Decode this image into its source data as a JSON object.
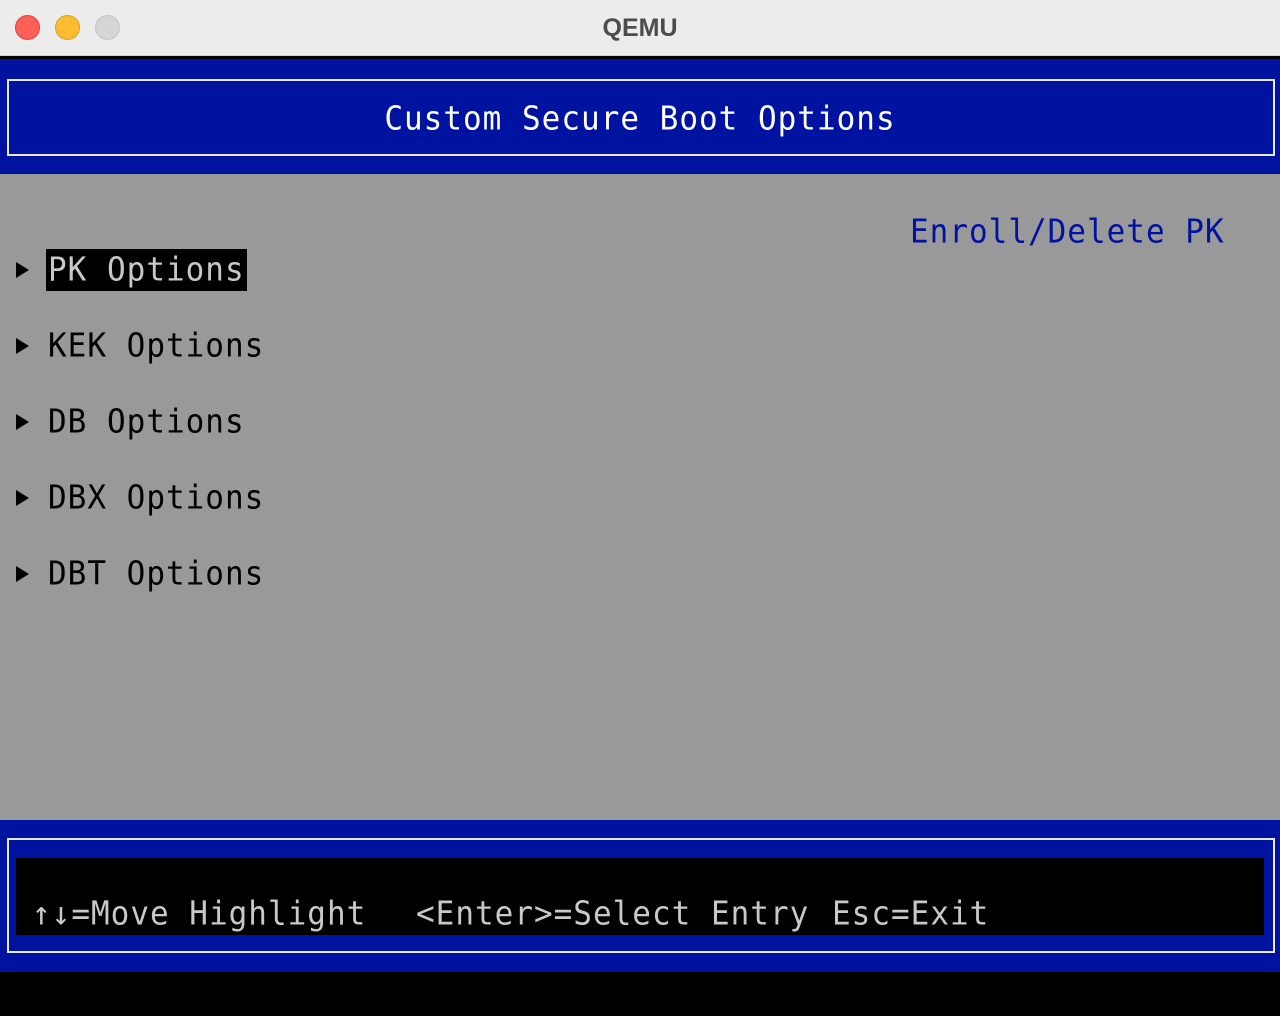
{
  "window": {
    "title": "QEMU"
  },
  "bios": {
    "page_title": "Custom Secure Boot Options",
    "help_text": "Enroll/Delete PK",
    "menu_items": [
      {
        "label": "PK Options",
        "selected": true
      },
      {
        "label": "KEK Options",
        "selected": false
      },
      {
        "label": "DB Options",
        "selected": false
      },
      {
        "label": "DBX Options",
        "selected": false
      },
      {
        "label": "DBT Options",
        "selected": false
      }
    ],
    "footer_hints": {
      "move": "↑↓=Move Highlight",
      "select": "<Enter>=Select Entry",
      "exit": "Esc=Exit"
    }
  },
  "colors": {
    "bios_blue": "#0012a0",
    "bios_gray": "#999999",
    "highlight_bg": "#000000",
    "highlight_fg": "#c8c8c8"
  }
}
